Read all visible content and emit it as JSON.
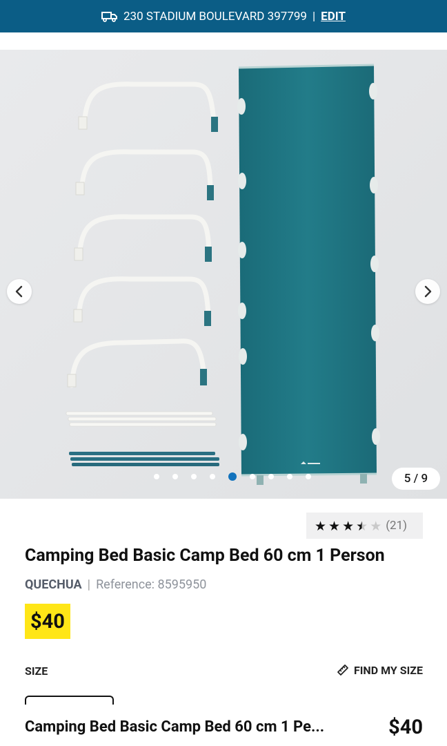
{
  "header": {
    "truck_icon": "delivery-truck-icon",
    "address": "230 STADIUM BOULEVARD 397799",
    "separator": "|",
    "edit_label": "EDIT"
  },
  "gallery": {
    "counter": "5 / 9",
    "dot_count": 9,
    "active_dot": 5,
    "prev_icon": "chevron-left-icon",
    "next_icon": "chevron-right-icon"
  },
  "product": {
    "rating_stars": 3.5,
    "rating_count": "(21)",
    "title": "Camping Bed Basic Camp Bed 60 cm 1 Person",
    "brand": "QUECHUA",
    "ref_separator": "|",
    "reference": "Reference: 8595950",
    "price": "$40",
    "size_label": "SIZE",
    "find_size_label": "FIND MY SIZE",
    "find_size_icon": "ruler-icon"
  },
  "sticky": {
    "title": "Camping Bed Basic Camp Bed 60 cm 1 Pe...",
    "price": "$40"
  },
  "colors": {
    "header_bg": "#0b5d86",
    "price_bg": "#ffe617",
    "active_dot": "#1273bd",
    "fabric": "#1f7683",
    "fabric_dark": "#1b6673"
  }
}
